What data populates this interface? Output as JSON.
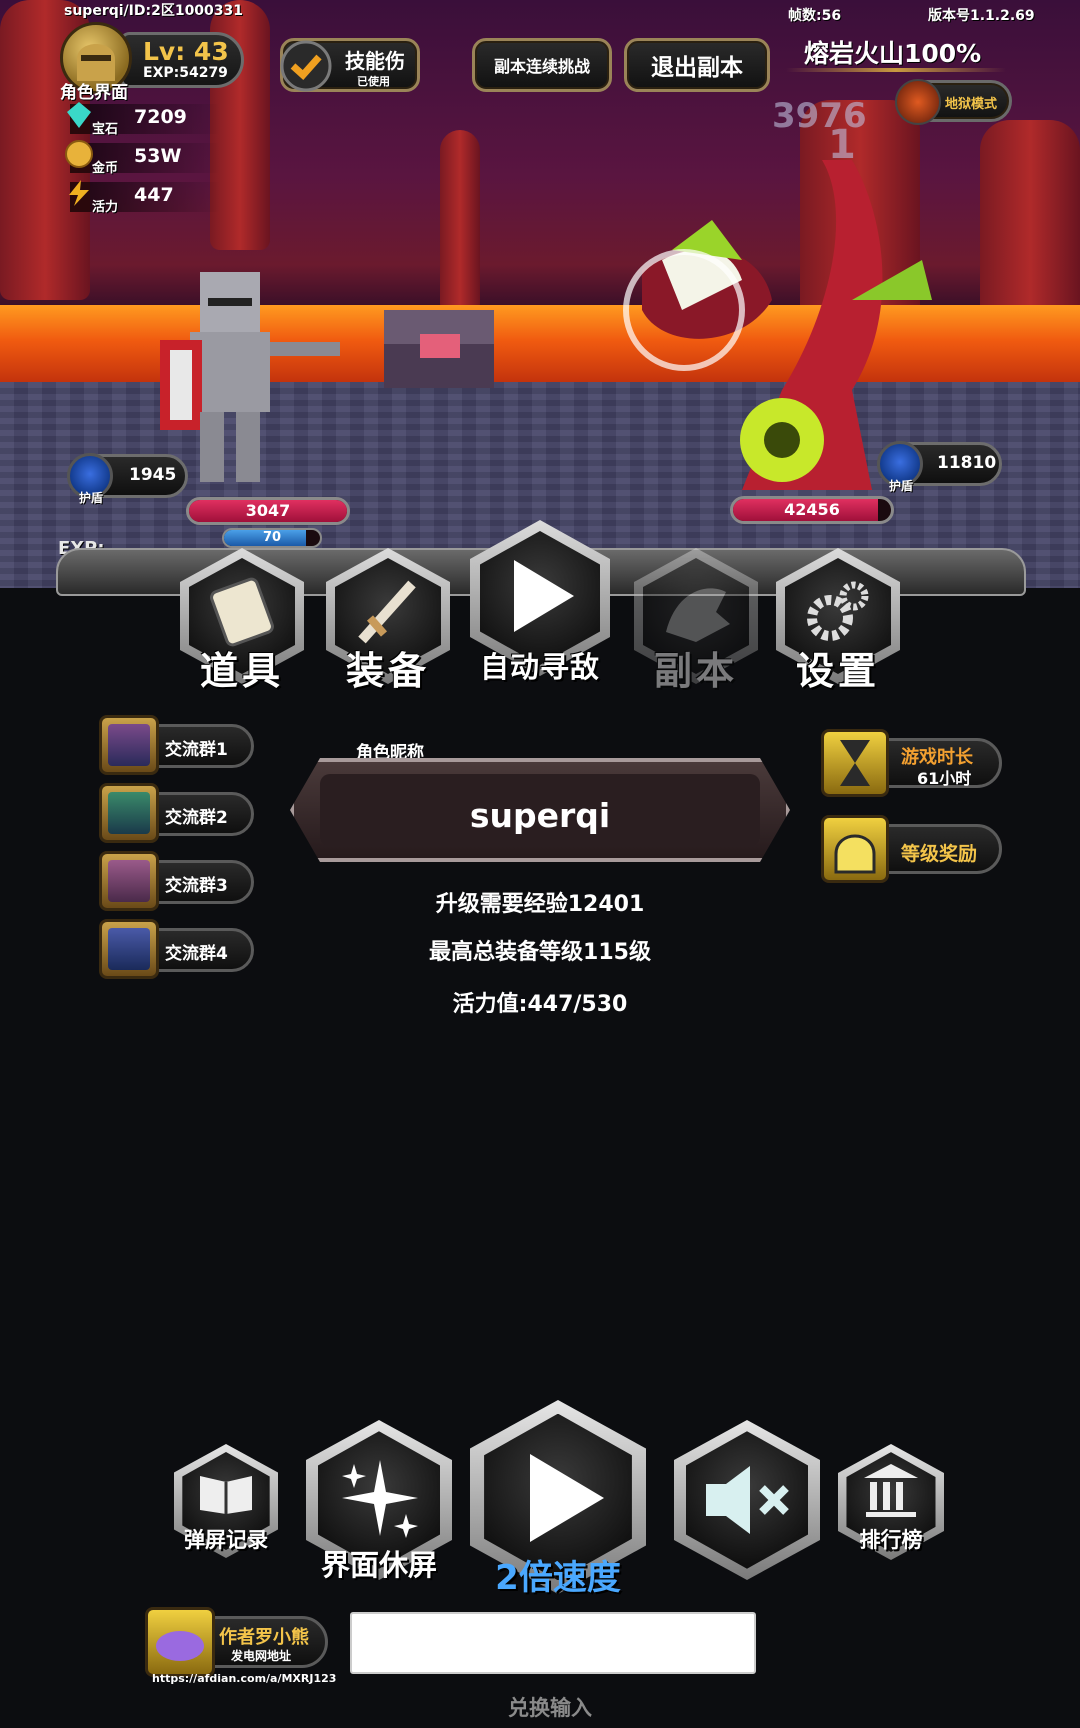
{
  "hud": {
    "player_id": "superqi/ID:2区1000331",
    "frames": "帧数:56",
    "version": "版本号1.1.2.69",
    "character_label": "角色界面",
    "level": "Lv: 43",
    "exp": "EXP:54279",
    "gems_label": "宝石",
    "gems": "7209",
    "gold_label": "金币",
    "gold": "53W",
    "energy_label": "活力",
    "energy": "447",
    "skill_button": "技能伤",
    "skill_status": "已使用",
    "dungeon_continue": "副本连续挑战",
    "dungeon_exit": "退出副本",
    "dungeon_name": "熔岩火山100%",
    "hell_mode": "地狱模式",
    "floating_damage": "3976",
    "floating_small": "1"
  },
  "player_unit": {
    "shield_label": "护盾",
    "shield": "1945",
    "hp": "3047",
    "hp_fraction": 1.0,
    "mana": "70",
    "mana_fraction": 0.85
  },
  "enemy_unit": {
    "shield_label": "护盾",
    "shield": "11810",
    "hp": "42456",
    "hp_fraction": 0.92
  },
  "exp_label": "EXP:",
  "nav": [
    {
      "label": "道具",
      "icon": "scroll-icon",
      "enabled": true
    },
    {
      "label": "装备",
      "icon": "sword-icon",
      "enabled": true
    },
    {
      "label": "自动寻敌",
      "icon": "play-icon",
      "enabled": true
    },
    {
      "label": "副本",
      "icon": "dragon-icon",
      "enabled": false
    },
    {
      "label": "设置",
      "icon": "gear-icon",
      "enabled": true
    }
  ],
  "groups": [
    {
      "label": "交流群1"
    },
    {
      "label": "交流群2"
    },
    {
      "label": "交流群3"
    },
    {
      "label": "交流群4"
    }
  ],
  "right_panel": {
    "playtime_label": "游戏时长",
    "playtime_value": "61小时",
    "level_reward": "等级奖励"
  },
  "profile": {
    "nickname_label": "角色昵称",
    "nickname": "superqi",
    "exp_needed": "升级需要经验12401",
    "max_gear": "最高总装备等级115级",
    "energy_value": "活力值:447/530"
  },
  "bottom_bar": {
    "danmaku_log": "弹屏记录",
    "screen_rest": "界面休屏",
    "speed": "2倍速度",
    "ranking": "排行榜"
  },
  "author": {
    "name": "作者罗小熊",
    "sub": "发电网地址",
    "url": "https://afdian.com/a/MXRJ123"
  },
  "redeem": {
    "label": "兑换输入",
    "value": "",
    "placeholder": ""
  },
  "colors": {
    "gold_text": "#f3c44a",
    "speed_text": "#4aa8ff",
    "hp": "#d22a5a",
    "mana": "#3a8ad8"
  }
}
